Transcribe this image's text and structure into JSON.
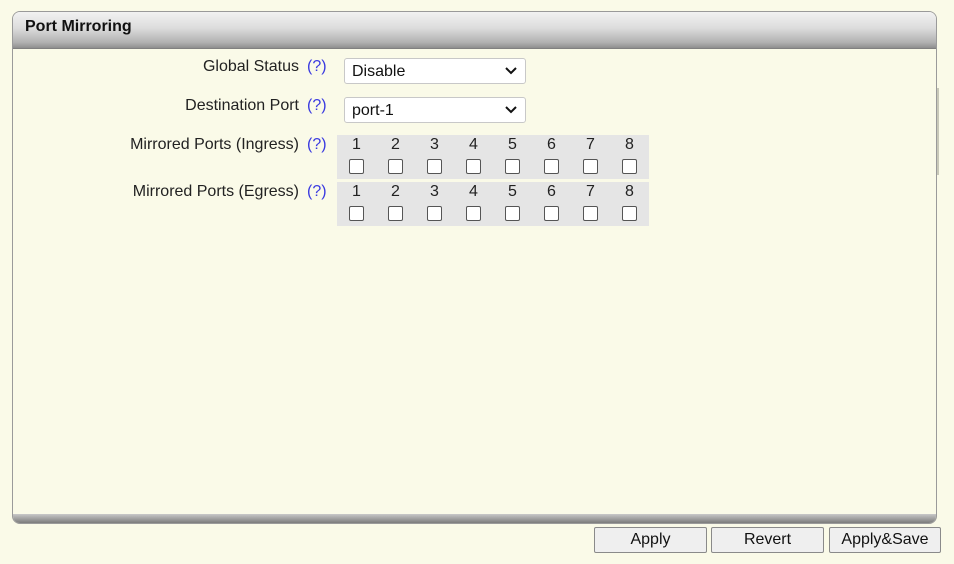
{
  "panel": {
    "title": "Port Mirroring"
  },
  "form": {
    "global_status": {
      "label": "Global Status",
      "help": "(?)",
      "value": "Disable"
    },
    "destination_port": {
      "label": "Destination Port",
      "help": "(?)",
      "value": "port-1"
    },
    "ingress": {
      "label": "Mirrored Ports (Ingress)",
      "help": "(?)",
      "ports": [
        "1",
        "2",
        "3",
        "4",
        "5",
        "6",
        "7",
        "8"
      ],
      "checked": [
        false,
        false,
        false,
        false,
        false,
        false,
        false,
        false
      ]
    },
    "egress": {
      "label": "Mirrored Ports (Egress)",
      "help": "(?)",
      "ports": [
        "1",
        "2",
        "3",
        "4",
        "5",
        "6",
        "7",
        "8"
      ],
      "checked": [
        false,
        false,
        false,
        false,
        false,
        false,
        false,
        false
      ]
    }
  },
  "buttons": {
    "apply": "Apply",
    "revert": "Revert",
    "apply_save": "Apply&Save"
  },
  "colors": {
    "background": "#fafae8",
    "help_link": "#3a3ae0",
    "port_grid_bg": "#e5e5e5"
  }
}
